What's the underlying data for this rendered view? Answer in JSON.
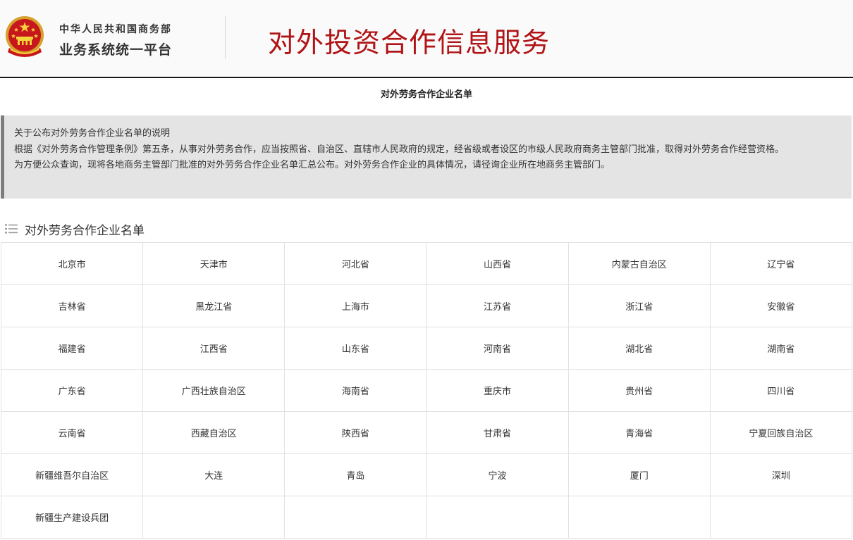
{
  "header": {
    "ministry_name": "中华人民共和国商务部",
    "platform_name": "业务系统统一平台",
    "service_title": "对外投资合作信息服务",
    "accent_color": "#b01417"
  },
  "page_title": "对外劳务合作企业名单",
  "notice": {
    "lines": [
      "关于公布对外劳务合作企业名单的说明",
      "根据《对外劳务合作管理条例》第五条，从事对外劳务合作，应当按照省、自治区、直辖市人民政府的规定，经省级或者设区的市级人民政府商务主管部门批准，取得对外劳务合作经营资格。",
      "为方便公众查询，现将各地商务主管部门批准的对外劳务合作企业名单汇总公布。对外劳务合作企业的具体情况，请径询企业所在地商务主管部门。"
    ]
  },
  "section": {
    "title": "对外劳务合作企业名单",
    "icon": "list-icon"
  },
  "regions": [
    [
      "北京市",
      "天津市",
      "河北省",
      "山西省",
      "内蒙古自治区",
      "辽宁省"
    ],
    [
      "吉林省",
      "黑龙江省",
      "上海市",
      "江苏省",
      "浙江省",
      "安徽省"
    ],
    [
      "福建省",
      "江西省",
      "山东省",
      "河南省",
      "湖北省",
      "湖南省"
    ],
    [
      "广东省",
      "广西壮族自治区",
      "海南省",
      "重庆市",
      "贵州省",
      "四川省"
    ],
    [
      "云南省",
      "西藏自治区",
      "陕西省",
      "甘肃省",
      "青海省",
      "宁夏回族自治区"
    ],
    [
      "新疆维吾尔自治区",
      "大连",
      "青岛",
      "宁波",
      "厦门",
      "深圳"
    ],
    [
      "新疆生产建设兵团",
      "",
      "",
      "",
      "",
      ""
    ]
  ]
}
